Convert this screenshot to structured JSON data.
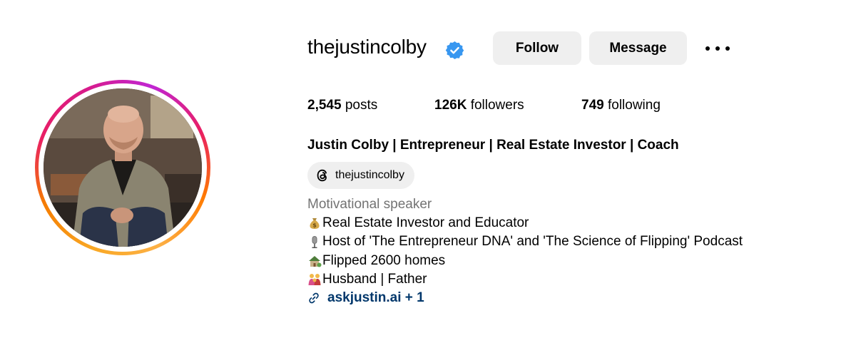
{
  "profile": {
    "username": "thejustincolby",
    "verified_icon": "verified-badge-icon",
    "full_name": "Justin Colby | Entrepreneur | Real Estate Investor | Coach",
    "category": "Motivational speaker"
  },
  "actions": {
    "follow_label": "Follow",
    "message_label": "Message",
    "more_icon": "more-options-icon"
  },
  "stats": {
    "posts_count": "2,545",
    "posts_label": "posts",
    "followers_count": "126K",
    "followers_label": "followers",
    "following_count": "749",
    "following_label": "following"
  },
  "threads": {
    "icon": "threads-icon",
    "handle": "thejustincolby"
  },
  "bio": {
    "lines": [
      {
        "icon": "money-bag-icon",
        "text": "Real Estate Investor and Educator"
      },
      {
        "icon": "microphone-icon",
        "text": "Host of 'The Entrepreneur DNA' and 'The Science of Flipping' Podcast"
      },
      {
        "icon": "house-icon",
        "text": "Flipped 2600 homes"
      },
      {
        "icon": "family-icon",
        "text": "Husband | Father"
      }
    ]
  },
  "link": {
    "icon": "link-icon",
    "text": "askjustin.ai + 1"
  },
  "colors": {
    "verified_blue": "#3897f0",
    "link_blue": "#00376b",
    "button_gray": "#efefef",
    "muted_text": "#737373"
  }
}
